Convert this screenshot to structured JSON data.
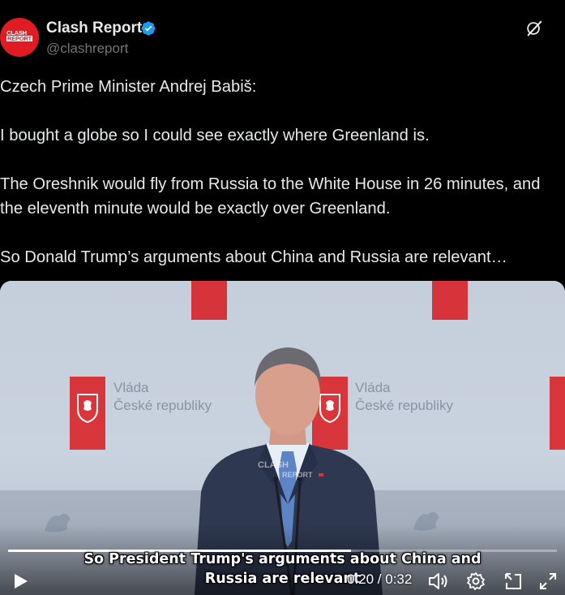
{
  "author": {
    "name": "Clash Report",
    "handle": "@clashreport",
    "avatar_text_1": "CLASH",
    "avatar_text_2": "REPORT",
    "verified": true
  },
  "icons": {
    "verified": "verified-badge-icon",
    "grok": "grok-icon",
    "play": "play-icon",
    "volume": "volume-icon",
    "settings": "gear-icon",
    "popout": "popout-icon",
    "fullscreen": "fullscreen-icon"
  },
  "tweet": {
    "line1": "Czech Prime Minister Andrej Babiš:",
    "line2": "I bought a globe so I could see exactly where Greenland is.",
    "line3": "The Oreshnik would fly from Russia to the White House in 26 minutes, and",
    "line4": "the eleventh minute would be exactly over Greenland.",
    "line5": "So Donald Trump’s arguments about China and Russia are relevant…"
  },
  "video": {
    "backdrop_text_1": "Vláda",
    "backdrop_text_2": "České republiky",
    "watermark_1": "CLASH",
    "watermark_2": "REPORT",
    "caption_line1": "So President Trump's arguments about China and",
    "caption_line2": "Russia are relevant",
    "current_time": "0:20",
    "duration": "0:32",
    "time_display": "0:20 / 0:32",
    "progress": 0.625
  },
  "colors": {
    "background": "#000000",
    "text": "#e7e9ea",
    "muted": "#71767b",
    "brand_red": "#e11b22",
    "verified_blue": "#1d9bf0"
  }
}
